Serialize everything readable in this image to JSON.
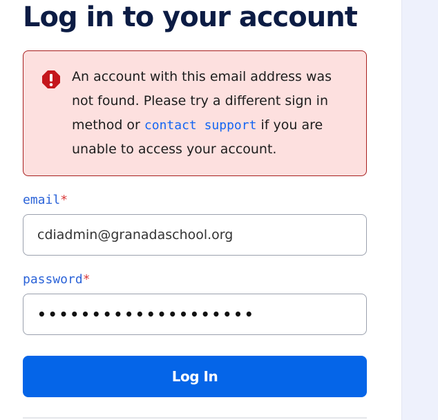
{
  "page": {
    "title": "Log in to your account"
  },
  "alert": {
    "icon": "error-octagon-icon",
    "text_before": "An account with this email address was not found. Please try a different sign in method or ",
    "link_label": "contact support",
    "text_after": " if you are unable to access your account."
  },
  "form": {
    "email": {
      "label": "email",
      "required_mark": "*",
      "value": "cdiadmin@granadaschool.org"
    },
    "password": {
      "label": "password",
      "required_mark": "*",
      "masked_value": "••••••••••••••••••••"
    },
    "submit_label": "Log In"
  },
  "colors": {
    "title": "#0c1c44",
    "alert_background": "#fde0df",
    "alert_border": "#a71d1d",
    "link": "#1565f2",
    "label": "#2b63d8",
    "required": "#d93a3a",
    "button": "#0565e8"
  }
}
